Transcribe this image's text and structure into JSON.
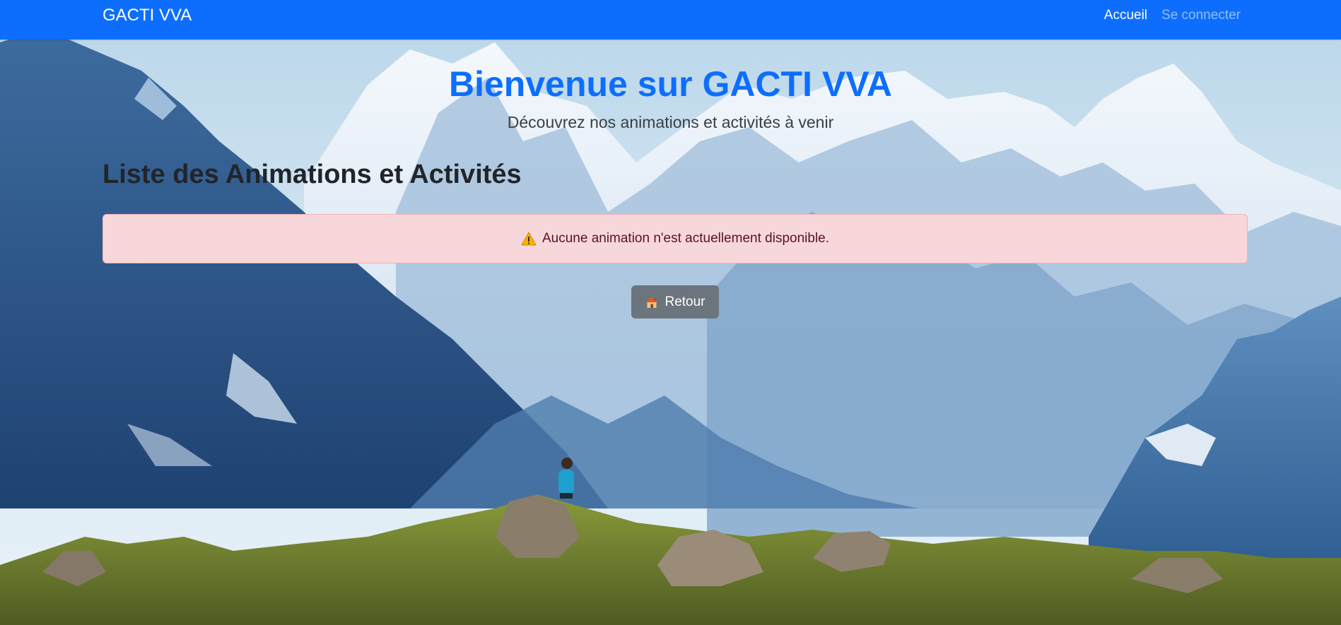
{
  "navbar": {
    "brand": "GACTI VVA",
    "links": [
      {
        "label": "Accueil",
        "state": "active"
      },
      {
        "label": "Se connecter",
        "state": "inactive"
      }
    ],
    "color": "#0d6efd"
  },
  "hero": {
    "title": "Bienvenue sur GACTI VVA",
    "subtitle": "Découvrez nos animations et activités à venir"
  },
  "section": {
    "title": "Liste des Animations et Activités"
  },
  "alert": {
    "icon": "warning-icon",
    "message": "Aucune animation n'est actuellement disponible.",
    "background": "#f8d7da"
  },
  "back_button": {
    "icon": "house-icon",
    "label": "Retour"
  },
  "background": {
    "subject": "mountain landscape"
  }
}
